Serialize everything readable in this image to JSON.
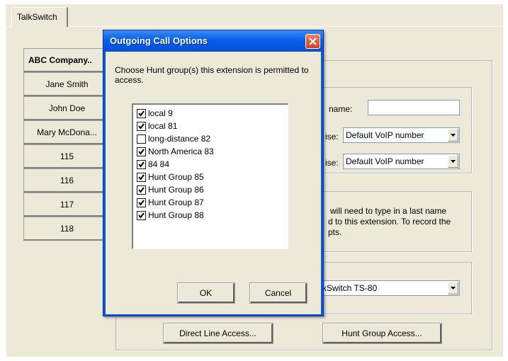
{
  "tab": {
    "label": "TalkSwitch"
  },
  "extensions": [
    {
      "label": "ABC Company..",
      "selected": true
    },
    {
      "label": "Jane Smith"
    },
    {
      "label": "John Doe"
    },
    {
      "label": "Mary McDona..."
    },
    {
      "label": "115"
    },
    {
      "label": "116"
    },
    {
      "label": "117"
    },
    {
      "label": "118"
    }
  ],
  "settings": {
    "name_label": "name:",
    "name_value": "",
    "line1_label": "ise:",
    "line1_value": "Default VoIP number",
    "line2_label": "ise:",
    "line2_value": "Default VoIP number",
    "info_line1": "will need to type in a last name",
    "info_line2": "d to this extension. To record the",
    "info_line3": "pts.",
    "system_value": "kSwitch TS-80",
    "direct_line_button": "Direct Line Access...",
    "hunt_group_button": "Hunt Group Access..."
  },
  "dialog": {
    "title": "Outgoing Call Options",
    "instruction": "Choose Hunt group(s) this extension is permitted to access.",
    "items": [
      {
        "label": "local 9",
        "checked": true
      },
      {
        "label": "local  81",
        "checked": true
      },
      {
        "label": "long-distance  82",
        "checked": false
      },
      {
        "label": "North America 83",
        "checked": true
      },
      {
        "label": "84 84",
        "checked": true
      },
      {
        "label": "Hunt Group 85",
        "checked": true
      },
      {
        "label": "Hunt Group 86",
        "checked": true
      },
      {
        "label": "Hunt Group 87",
        "checked": true
      },
      {
        "label": "Hunt Group 88",
        "checked": true
      }
    ],
    "ok_label": "OK",
    "cancel_label": "Cancel"
  }
}
